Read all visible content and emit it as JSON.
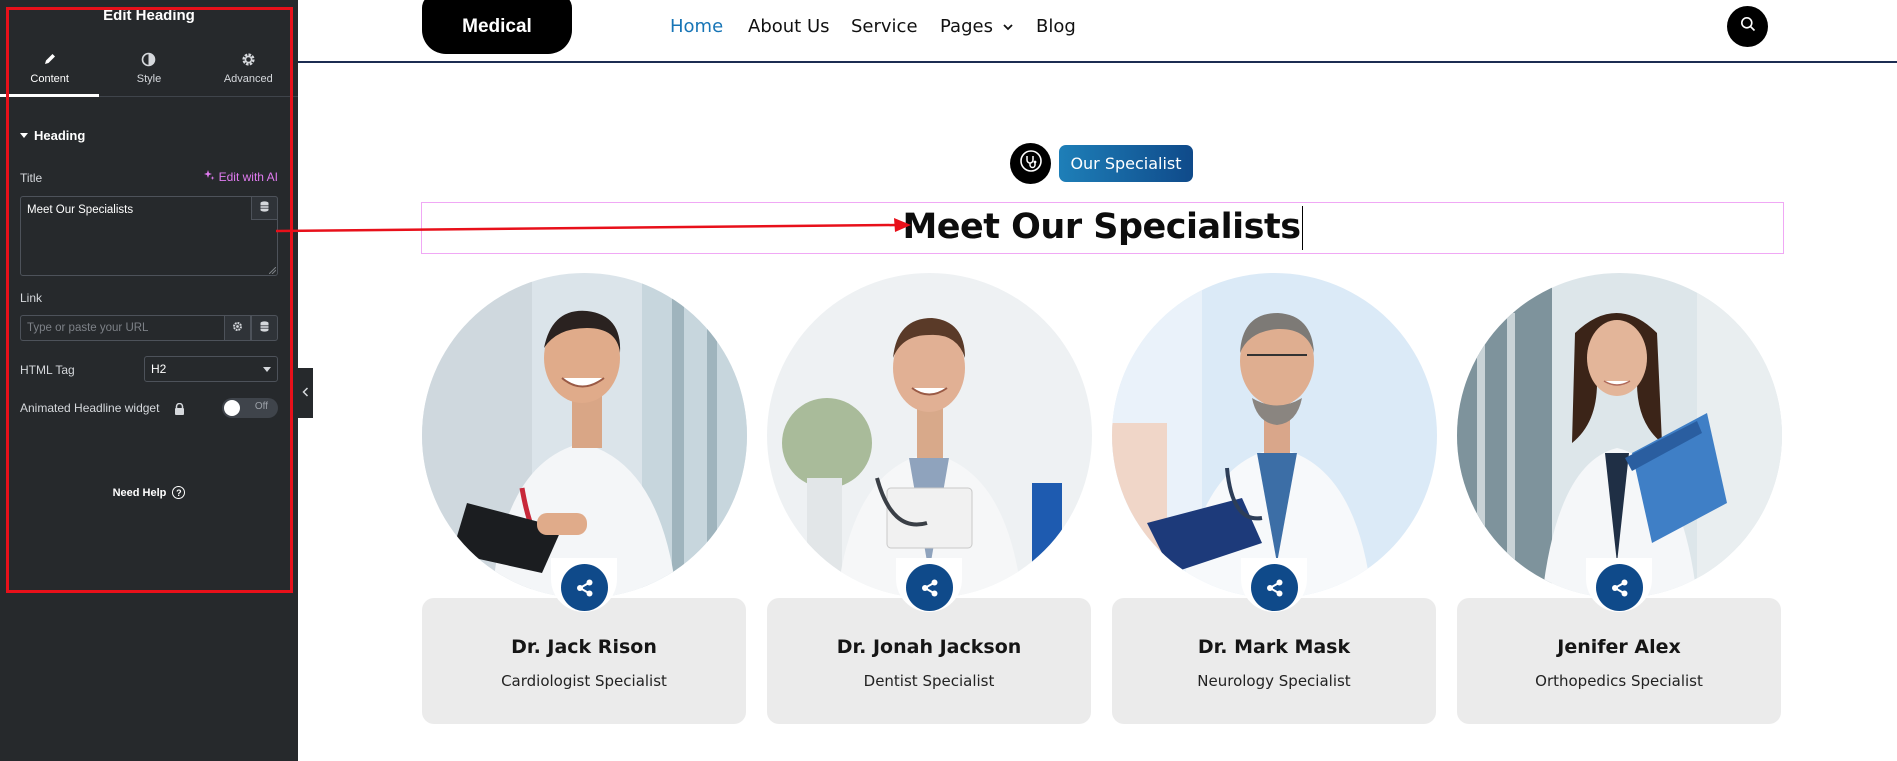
{
  "editor": {
    "title": "Edit Heading",
    "tabs": [
      {
        "label": "Content",
        "icon": "pencil-icon",
        "active": true
      },
      {
        "label": "Style",
        "icon": "contrast-icon",
        "active": false
      },
      {
        "label": "Advanced",
        "icon": "gear-icon",
        "active": false
      }
    ],
    "section": "Heading",
    "title_label": "Title",
    "edit_ai_label": "Edit with AI",
    "title_value": "Meet Our Specialists",
    "link_label": "Link",
    "link_placeholder": "Type or paste your URL",
    "html_tag_label": "HTML Tag",
    "html_tag_value": "H2",
    "animated_label": "Animated Headline widget",
    "toggle_text": "Off",
    "help_label": "Need Help",
    "accent_color": "#e07bf0",
    "highlight_color": "#e8101a"
  },
  "site": {
    "logo": "Medical",
    "nav": [
      "Home",
      "About Us",
      "Service",
      "Pages",
      "Blog"
    ],
    "active_nav": "Home",
    "badge": "Our Specialist",
    "heading": "Meet Our Specialists",
    "brand_color": "#0f4a8a",
    "doctors": [
      {
        "name": "Dr. Jack Rison",
        "role": "Cardiologist Specialist"
      },
      {
        "name": "Dr. Jonah Jackson",
        "role": "Dentist Specialist"
      },
      {
        "name": "Dr. Mark Mask",
        "role": "Neurology Specialist"
      },
      {
        "name": "Jenifer Alex",
        "role": "Orthopedics Specialist"
      }
    ]
  }
}
